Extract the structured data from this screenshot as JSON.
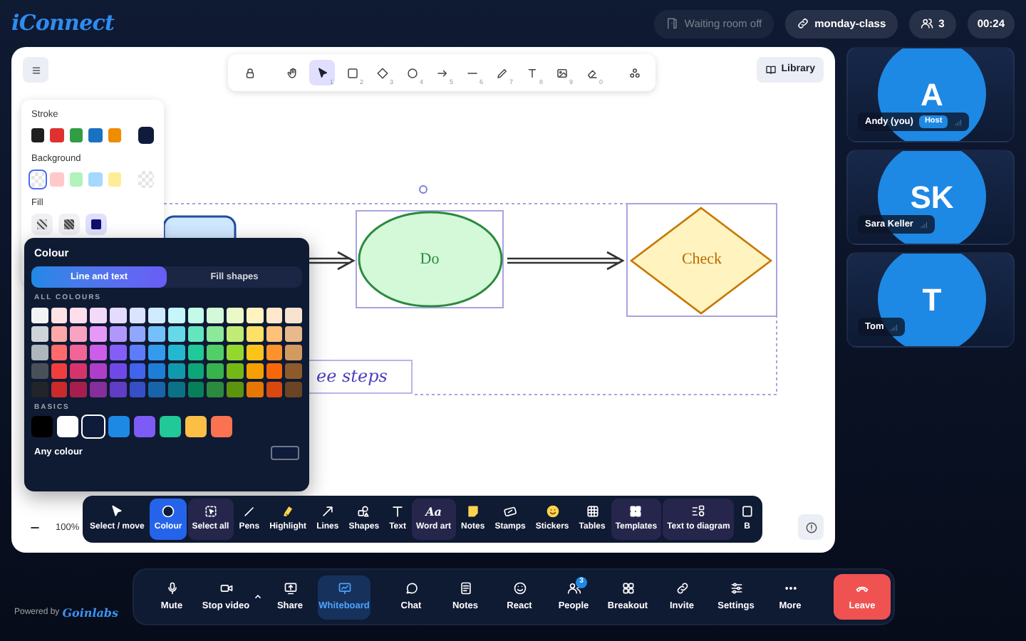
{
  "header": {
    "logo": "iConnect",
    "waiting_room": "Waiting room off",
    "room_link": "monday-class",
    "participant_count": "3",
    "timer": "00:24"
  },
  "whiteboard": {
    "top_tools": [
      {
        "kind": "lock",
        "selected": false
      },
      {
        "kind": "hand",
        "selected": false
      },
      {
        "kind": "select",
        "key": "1",
        "selected": true
      },
      {
        "kind": "rectangle",
        "key": "2",
        "selected": false
      },
      {
        "kind": "diamond",
        "key": "3",
        "selected": false
      },
      {
        "kind": "ellipse",
        "key": "4",
        "selected": false
      },
      {
        "kind": "arrow",
        "key": "5",
        "selected": false
      },
      {
        "kind": "line",
        "key": "6",
        "selected": false
      },
      {
        "kind": "pencil",
        "key": "7",
        "selected": false
      },
      {
        "kind": "text",
        "key": "8",
        "selected": false
      },
      {
        "kind": "image",
        "key": "9",
        "selected": false
      },
      {
        "kind": "eraser",
        "key": "0",
        "selected": false
      },
      {
        "kind": "extra",
        "selected": false
      }
    ],
    "library": "Library",
    "properties": {
      "stroke_label": "Stroke",
      "stroke": [
        {
          "color": "#1e1e1e",
          "selected": false
        },
        {
          "color": "#e03131",
          "selected": false
        },
        {
          "color": "#2f9e44",
          "selected": false
        },
        {
          "color": "#1971c2",
          "selected": false
        },
        {
          "color": "#f08c00",
          "selected": false
        }
      ],
      "stroke_current": {
        "color": "#0f1b3a"
      },
      "background_label": "Background",
      "background": [
        {
          "kind": "transparent",
          "selected": true
        },
        {
          "kind": "swatch",
          "color": "#ffc9c9",
          "selected": false
        },
        {
          "kind": "swatch",
          "color": "#b2f2bb",
          "selected": false
        },
        {
          "kind": "swatch",
          "color": "#a5d8ff",
          "selected": false
        },
        {
          "kind": "swatch",
          "color": "#ffec99",
          "selected": false
        }
      ],
      "background_current": {
        "kind": "transparent"
      },
      "fill_label": "Fill",
      "fill": [
        {
          "kind": "hachure",
          "selected": false
        },
        {
          "kind": "cross",
          "selected": false
        },
        {
          "kind": "solid",
          "selected": true
        }
      ]
    },
    "canvas": {
      "ellipse_text": "Do",
      "diamond_text": "Check",
      "handwriting": "ee steps"
    },
    "colour_picker": {
      "title": "Colour",
      "tabs": [
        {
          "label": "Line and text",
          "selected": true
        },
        {
          "label": "Fill shapes",
          "selected": false
        }
      ],
      "all_colours_label": "ALL COLOURS",
      "grid": [
        [
          {
            "color": "#f1f3f5"
          },
          {
            "color": "#ffe3e3"
          },
          {
            "color": "#ffdeeb"
          },
          {
            "color": "#f3d9fa"
          },
          {
            "color": "#e5dbff"
          },
          {
            "color": "#dbe4ff"
          },
          {
            "color": "#d0ebff"
          },
          {
            "color": "#c5f6fa"
          },
          {
            "color": "#c3fae8"
          },
          {
            "color": "#d3f9d8"
          },
          {
            "color": "#e9fac8"
          },
          {
            "color": "#fff3bf"
          },
          {
            "color": "#ffe8cc"
          },
          {
            "color": "#f8e3d0"
          }
        ],
        [
          {
            "color": "#ced4da"
          },
          {
            "color": "#ffa8a8"
          },
          {
            "color": "#faa2c1"
          },
          {
            "color": "#e599f7"
          },
          {
            "color": "#b197fc"
          },
          {
            "color": "#91a7ff"
          },
          {
            "color": "#74c0fc"
          },
          {
            "color": "#66d9e8"
          },
          {
            "color": "#63e6be"
          },
          {
            "color": "#8ce99a"
          },
          {
            "color": "#c0eb75"
          },
          {
            "color": "#ffe066"
          },
          {
            "color": "#ffc078"
          },
          {
            "color": "#e8b98a"
          }
        ],
        [
          {
            "color": "#adb5bd"
          },
          {
            "color": "#ff6b6b"
          },
          {
            "color": "#f06595"
          },
          {
            "color": "#cc5de8"
          },
          {
            "color": "#845ef7"
          },
          {
            "color": "#5c7cfa"
          },
          {
            "color": "#339af0"
          },
          {
            "color": "#22b8cf"
          },
          {
            "color": "#20c997"
          },
          {
            "color": "#51cf66"
          },
          {
            "color": "#94d82d"
          },
          {
            "color": "#fcc419"
          },
          {
            "color": "#ff922b"
          },
          {
            "color": "#d39a5f"
          }
        ],
        [
          {
            "color": "#495057"
          },
          {
            "color": "#f03e3e"
          },
          {
            "color": "#d6336c"
          },
          {
            "color": "#ae3ec9"
          },
          {
            "color": "#7048e8"
          },
          {
            "color": "#4263eb"
          },
          {
            "color": "#1c7ed6"
          },
          {
            "color": "#1098ad"
          },
          {
            "color": "#0ca678"
          },
          {
            "color": "#37b24d"
          },
          {
            "color": "#74b816"
          },
          {
            "color": "#f59f00"
          },
          {
            "color": "#f76707"
          },
          {
            "color": "#8c5a2b"
          }
        ],
        [
          {
            "color": "#212529"
          },
          {
            "color": "#c92a2a"
          },
          {
            "color": "#a61e4d"
          },
          {
            "color": "#862e9c"
          },
          {
            "color": "#5f3dc4"
          },
          {
            "color": "#364fc7"
          },
          {
            "color": "#1864ab"
          },
          {
            "color": "#0b7285"
          },
          {
            "color": "#087f5b"
          },
          {
            "color": "#2b8a3e"
          },
          {
            "color": "#5c940d"
          },
          {
            "color": "#e67700"
          },
          {
            "color": "#d9480f"
          },
          {
            "color": "#6b4423"
          }
        ]
      ],
      "basics_label": "BASICS",
      "basics": [
        {
          "color": "#000000",
          "selected": false
        },
        {
          "color": "#ffffff",
          "selected": false
        },
        {
          "color": "#0f1b3a",
          "selected": true
        },
        {
          "color": "#1e88e5",
          "selected": false
        },
        {
          "color": "#7c5cf5",
          "selected": false
        },
        {
          "color": "#20c997",
          "selected": false
        },
        {
          "color": "#fbbf45",
          "selected": false
        },
        {
          "color": "#f97352",
          "selected": false
        }
      ],
      "any_colour_label": "Any colour",
      "custom_swatch": {
        "color": "#0f1b3a"
      }
    },
    "toolbar": [
      {
        "kind": "select",
        "label": "Select / move",
        "selected": false,
        "highlighted": false
      },
      {
        "kind": "colour",
        "label": "Colour",
        "selected": true
      },
      {
        "kind": "select_all",
        "label": "Select all",
        "selected": false,
        "highlighted": true
      },
      {
        "kind": "pens",
        "label": "Pens",
        "selected": false,
        "highlighted": false
      },
      {
        "kind": "highlight",
        "label": "Highlight",
        "selected": false,
        "highlighted": false
      },
      {
        "kind": "lines",
        "label": "Lines",
        "selected": false,
        "highlighted": false
      },
      {
        "kind": "shapes",
        "label": "Shapes",
        "selected": false,
        "highlighted": false
      },
      {
        "kind": "text",
        "label": "Text",
        "selected": false,
        "highlighted": false
      },
      {
        "kind": "word_art",
        "glyph": "Aa",
        "label": "Word art",
        "selected": false,
        "highlighted": true
      },
      {
        "kind": "notes",
        "label": "Notes",
        "selected": false,
        "highlighted": false
      },
      {
        "kind": "stamps",
        "label": "Stamps",
        "selected": false,
        "highlighted": false
      },
      {
        "kind": "stickers",
        "label": "Stickers",
        "selected": false,
        "highlighted": false
      },
      {
        "kind": "tables",
        "label": "Tables",
        "selected": false,
        "highlighted": false
      },
      {
        "kind": "templates",
        "label": "Templates",
        "selected": false,
        "highlighted": true
      },
      {
        "kind": "text_to_diagram",
        "label": "Text to diagram",
        "selected": false,
        "highlighted": true
      },
      {
        "kind": "cut",
        "label": "B",
        "selected": false,
        "highlighted": false
      }
    ],
    "zoom": "100%"
  },
  "participants": [
    {
      "initials": "A",
      "name": "Andy (you)",
      "badge": "Host"
    },
    {
      "initials": "SK",
      "name": "Sara Keller"
    },
    {
      "initials": "T",
      "name": "Tom"
    }
  ],
  "footer": {
    "powered_by": "Powered by",
    "brand": "Goinlabs",
    "controls": [
      {
        "kind": "mic",
        "label": "Mute",
        "selected": false
      },
      {
        "kind": "video",
        "label": "Stop video",
        "selected": false,
        "caret": true
      },
      {
        "kind": "share",
        "label": "Share",
        "selected": false
      },
      {
        "kind": "whiteboard",
        "label": "Whiteboard",
        "selected": true
      },
      {
        "kind": "chat",
        "label": "Chat",
        "selected": false
      },
      {
        "kind": "notes",
        "label": "Notes",
        "selected": false
      },
      {
        "kind": "react",
        "label": "React",
        "selected": false
      },
      {
        "kind": "people",
        "label": "People",
        "selected": false,
        "badge": "3"
      },
      {
        "kind": "breakout",
        "label": "Breakout",
        "selected": false
      },
      {
        "kind": "invite",
        "label": "Invite",
        "selected": false
      },
      {
        "kind": "settings",
        "label": "Settings",
        "selected": false
      },
      {
        "kind": "more",
        "label": "More",
        "selected": false
      },
      {
        "kind": "leave",
        "label": "Leave"
      }
    ]
  }
}
